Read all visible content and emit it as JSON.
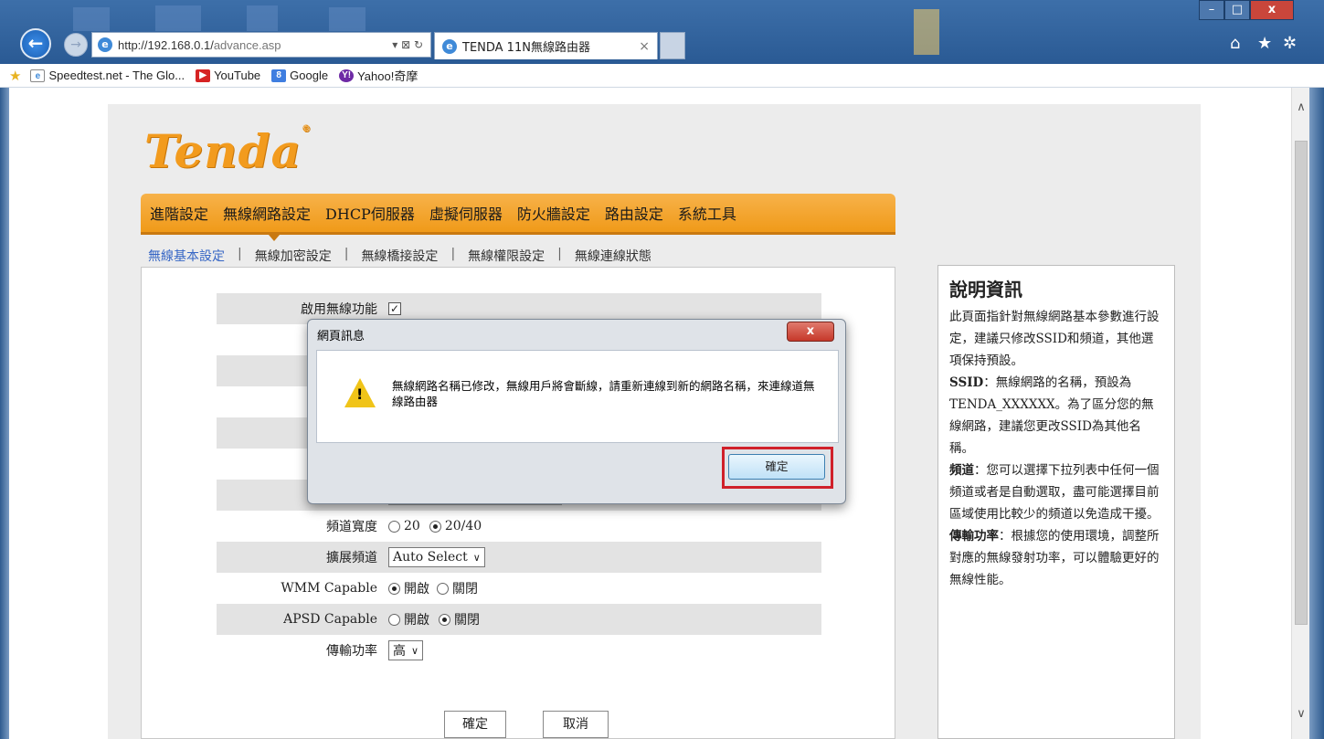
{
  "browser": {
    "back_label": "←",
    "forward_label": "→",
    "url_main": "http://192.168.0.1/",
    "url_path": "advance.asp",
    "address_controls": "▾ ⊠ ↻",
    "tab_title": "TENDA 11N無線路由器",
    "tab_close": "×",
    "window_min": "–",
    "window_max": "□",
    "window_close": "x",
    "tool_home": "⌂",
    "tool_star": "★",
    "tool_gear": "✲"
  },
  "favorites": [
    {
      "label": "Speedtest.net - The Glo...",
      "icon": "page-icon",
      "glyph": "e"
    },
    {
      "label": "YouTube",
      "icon": "youtube-icon",
      "glyph": "▶"
    },
    {
      "label": "Google",
      "icon": "google-icon",
      "glyph": "8"
    },
    {
      "label": "Yahoo!奇摩",
      "icon": "yahoo-icon",
      "glyph": "Y!"
    }
  ],
  "router": {
    "logo": "Tenda",
    "logo_mark": "®",
    "main_nav": [
      "進階設定",
      "無線網路設定",
      "DHCP伺服器",
      "虛擬伺服器",
      "防火牆設定",
      "路由設定",
      "系統工具"
    ],
    "sub_nav": [
      "無線基本設定",
      "無線加密設定",
      "無線橋接設定",
      "無線權限設定",
      "無線連線狀態"
    ],
    "sub_nav_sep": "|",
    "form": {
      "enable_label": "啟用無線功能",
      "enable_check": "✓",
      "bandwidth_label": "頻道寬度",
      "bandwidth_20": "20",
      "bandwidth_2040": "20/40",
      "ext_channel_label": "擴展頻道",
      "ext_channel_value": "Auto Select",
      "wmm_label": "WMM Capable",
      "apsd_label": "APSD Capable",
      "on_label": "開啟",
      "off_label": "關閉",
      "power_label": "傳輸功率",
      "power_value": "高",
      "chevron": "∨"
    },
    "ok_button": "確定",
    "cancel_button": "取消",
    "help": {
      "title": "說明資訊",
      "intro": "此頁面指針對無線網路基本參數進行設定，建議只修改SSID和頻道，其他選項保持預設。",
      "ssid_term": "SSID",
      "ssid_text": "：無線網路的名稱，預設為TENDA_XXXXXX。為了區分您的無線網路，建議您更改SSID為其他名稱。",
      "channel_term": "頻道",
      "channel_text": "：您可以選擇下拉列表中任何一個頻道或者是自動選取，盡可能選擇目前區域使用比較少的頻道以免造成干擾。",
      "power_term": "傳輸功率",
      "power_text": "：根據您的使用環境，調整所對應的無線發射功率，可以體驗更好的無線性能。"
    }
  },
  "dialog": {
    "title": "網頁訊息",
    "close": "x",
    "warning_mark": "!",
    "message": "無線網路名稱已修改，無線用戶將會斷線，請重新連線到新的網路名稱，來連線道無線路由器",
    "ok": "確定"
  },
  "scroll": {
    "up": "∧",
    "down": "∨"
  }
}
